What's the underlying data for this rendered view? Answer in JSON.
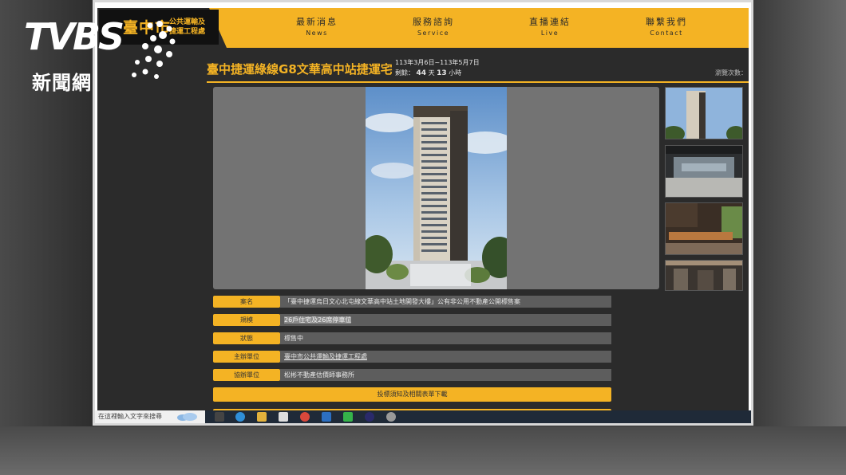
{
  "site": {
    "city": "臺中市",
    "dept_line1": "公共運輸及",
    "dept_line2": "捷運工程處"
  },
  "nav": [
    {
      "zh": "最新消息",
      "en": "News"
    },
    {
      "zh": "服務諮詢",
      "en": "Service"
    },
    {
      "zh": "直播連結",
      "en": "Live"
    },
    {
      "zh": "聯繫我們",
      "en": "Contact"
    }
  ],
  "listing": {
    "title": "臺中捷運綠線G8文華高中站捷運宅",
    "date_range": "113年3月6日~113年5月7日",
    "remain_prefix": "剩餘：",
    "remain_days": "44",
    "remain_days_unit": "天",
    "remain_hours": "13",
    "remain_hours_unit": "小時",
    "views": "瀏覽次數："
  },
  "info": [
    {
      "label": "案名",
      "value": "「臺中捷運烏日文心北屯線文華高中站土地開發大樓」公有非公用不動產公開標售案",
      "style": "plain"
    },
    {
      "label": "規模",
      "value": "26戶住宅及26席停車位",
      "style": "highlight"
    },
    {
      "label": "狀態",
      "value": "標售中",
      "style": "plain"
    },
    {
      "label": "主辦單位",
      "value": "臺中市公共運輸及捷運工程處",
      "style": "link"
    },
    {
      "label": "協辦單位",
      "value": "松彬不動產估價師事務所",
      "style": "plain"
    }
  ],
  "download_label": "投標須知及相關表單下載",
  "taskbar": {
    "search_placeholder": "在這裡輸入文字來搜尋"
  },
  "watermark": {
    "brand": "TVBS",
    "channel": "新聞網"
  },
  "colors": {
    "accent": "#f4b324",
    "dark": "#2b2b2b"
  }
}
